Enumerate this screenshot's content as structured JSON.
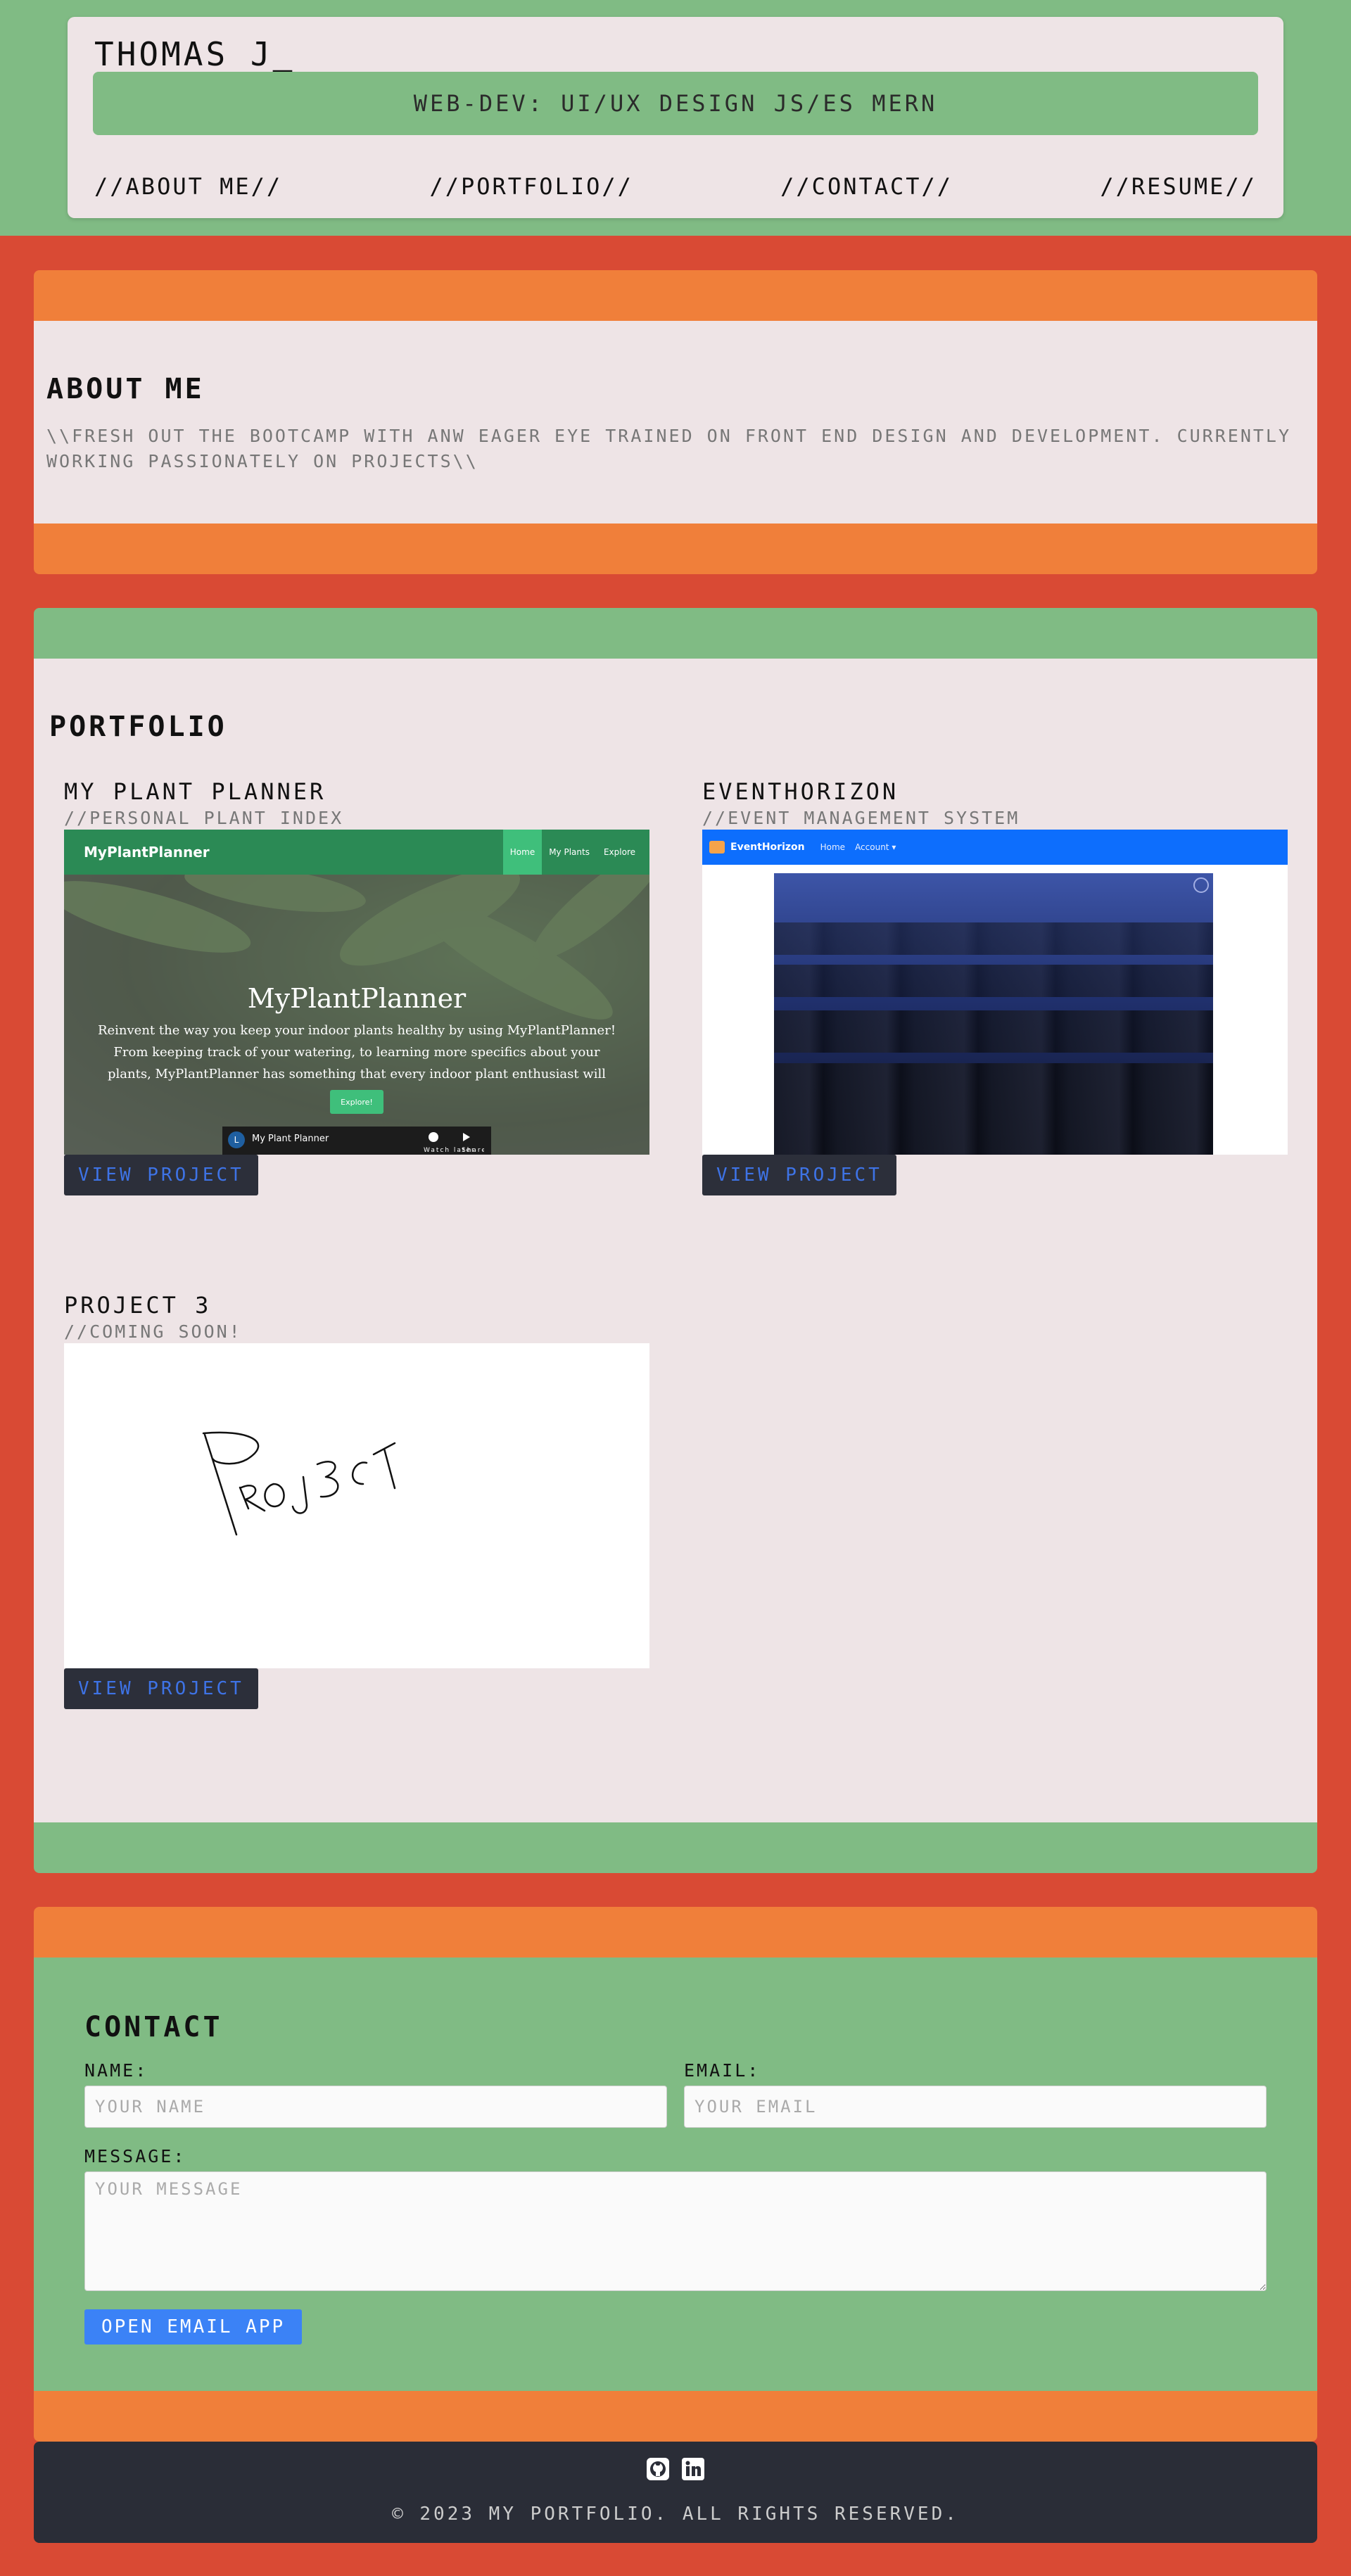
{
  "header": {
    "title": "THOMAS J",
    "cursor": "_",
    "tagline": "WEB-DEV: UI/UX DESIGN JS/ES MERN",
    "nav": [
      "//ABOUT ME//",
      "//PORTFOLIO//",
      "//CONTACT//",
      "//RESUME//"
    ]
  },
  "about": {
    "title": "ABOUT ME",
    "text": "\\\\FRESH OUT THE BOOTCAMP WITH ANW EAGER EYE TRAINED ON FRONT END DESIGN AND DEVELOPMENT. CURRENTLY WORKING PASSIONATELY ON PROJECTS\\\\"
  },
  "portfolio": {
    "title": "PORTFOLIO",
    "projects": [
      {
        "title": "MY PLANT PLANNER",
        "subtitle": "//PERSONAL PLANT INDEX",
        "button": "VIEW PROJECT",
        "screenshot": {
          "brand": "MyPlantPlanner",
          "nav": [
            "Home",
            "My Plants",
            "Explore"
          ],
          "heading": "MyPlantPlanner",
          "description": "Reinvent the way you keep your indoor plants healthy by using MyPlantPlanner! From keeping track of your watering, to learning more specifics about your plants, MyPlantPlanner has something that every indoor plant enthusiast will love!",
          "cta": "Explore!",
          "video_title": "My Plant Planner",
          "video_avatar": "L",
          "video_actions": [
            "Watch later",
            "Share"
          ]
        }
      },
      {
        "title": "EVENTHORIZON",
        "subtitle": "//EVENT MANAGEMENT SYSTEM",
        "button": "VIEW PROJECT",
        "screenshot": {
          "brand": "EventHorizon",
          "nav": [
            "Home",
            "Account ▾"
          ]
        }
      },
      {
        "title": "PROJECT 3",
        "subtitle": "//COMING SOON!",
        "button": "VIEW PROJECT",
        "screenshot": {
          "sketch_text": "PROJECT"
        }
      }
    ]
  },
  "contact": {
    "title": "CONTACT",
    "name_label": "NAME:",
    "name_placeholder": "YOUR NAME",
    "email_label": "EMAIL:",
    "email_placeholder": "YOUR EMAIL",
    "message_label": "MESSAGE:",
    "message_placeholder": "YOUR MESSAGE",
    "button": "OPEN EMAIL APP"
  },
  "footer": {
    "icons": [
      "github-icon",
      "linkedin-icon"
    ],
    "copyright": "© 2023 MY PORTFOLIO. ALL RIGHTS RESERVED."
  },
  "colors": {
    "page_bg": "#d94a34",
    "green": "#80bb84",
    "orange": "#f07f3a",
    "card": "#eee4e6",
    "dark": "#2a2d37",
    "link_blue": "#3e73e6",
    "button_blue": "#3b82f6"
  }
}
